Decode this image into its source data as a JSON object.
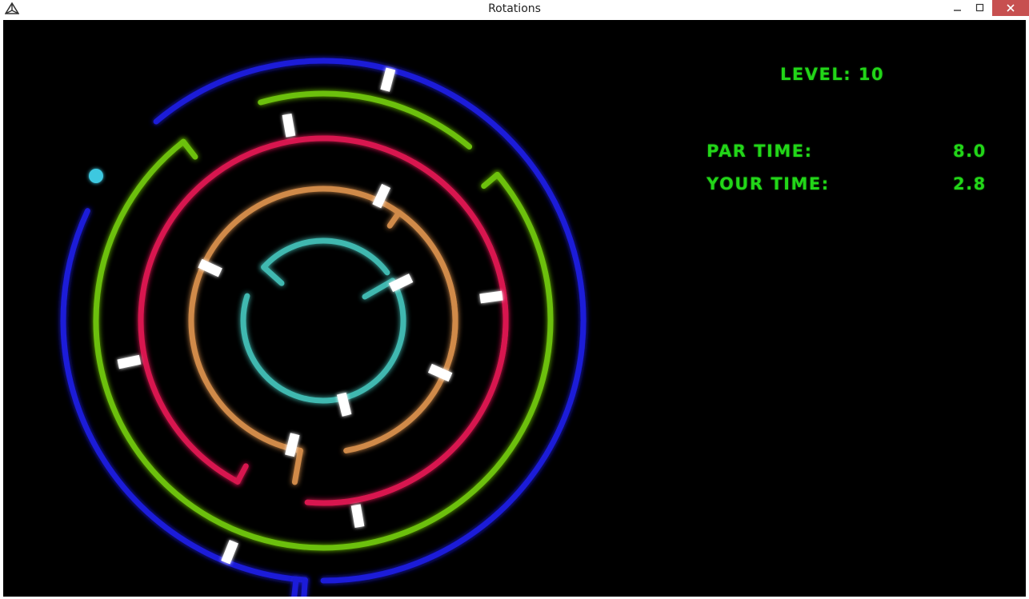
{
  "window": {
    "title": "Rotations",
    "app_icon": "unity-icon",
    "controls": {
      "minimize_icon": "minimize-icon",
      "maximize_icon": "maximize-icon",
      "close_icon": "close-icon"
    }
  },
  "hud": {
    "level_label": "LEVEL: 10",
    "par_time_label": "PAR TIME:",
    "par_time_value": "8.0",
    "your_time_label": "YOUR TIME:",
    "your_time_value": "2.8"
  },
  "colors": {
    "hud_text": "#22d618",
    "background": "#000000",
    "ball": "#3cc8e0",
    "gate": "#ffffff",
    "ring_blue": "#1a1ad8",
    "ring_green": "#6cc010",
    "ring_red": "#d81850",
    "ring_orange": "#d08a48",
    "ring_teal": "#40b8b0"
  },
  "maze": {
    "rings": [
      {
        "name": "ring-blue",
        "color": "#1a1ad8"
      },
      {
        "name": "ring-green",
        "color": "#6cc010"
      },
      {
        "name": "ring-red",
        "color": "#d81850"
      },
      {
        "name": "ring-orange",
        "color": "#d08a48"
      },
      {
        "name": "ring-teal",
        "color": "#40b8b0"
      }
    ],
    "ball": {
      "name": "player-ball",
      "color": "#3cc8e0"
    }
  }
}
